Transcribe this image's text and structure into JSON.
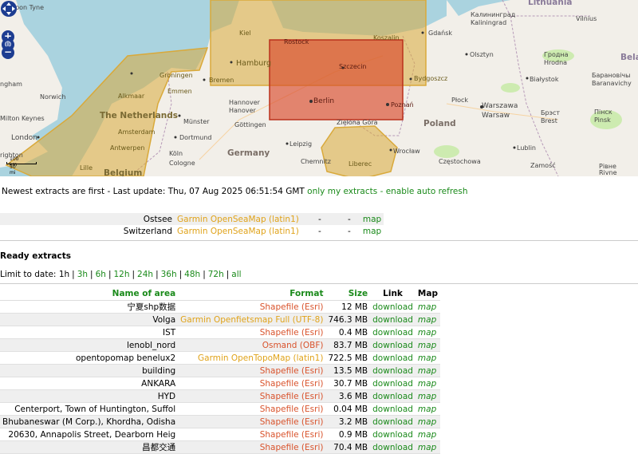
{
  "map": {
    "labels": {
      "newcastle": "upon Tyne",
      "lithuania": "Lithuania",
      "vilnius": "Vilnius",
      "kaliningrad_ru": "Калининград",
      "kaliningrad": "Kaliningrad",
      "gdansk": "Gdańsk",
      "olsztyn": "Olsztyn",
      "grodno_ru": "Гродна",
      "grodno": "Hrodna",
      "bela": "Bela",
      "bialystok": "Białystok",
      "baranovichi_ru": "Барановічы",
      "baranovichi": "Baranavichy",
      "kiel": "Kiel",
      "rostock": "Rostock",
      "koszalin": "Koszalin",
      "hamburg": "Hamburg",
      "szczecin": "Szczecin",
      "bydgoszcz": "Bydgoszcz",
      "bremen": "Bremen",
      "groningen": "Groningen",
      "emmen": "Emmen",
      "ngham": "ngham",
      "norwich": "Norwich",
      "alkmaar": "Alkmaar",
      "hannover": "Hannover",
      "hannover2": "Hanover",
      "berlin": "Berlin",
      "poznan": "Poznań",
      "plock": "Płock",
      "warszawa": "Warszawa",
      "warsaw": "Warsaw",
      "brest_ru": "Брэст",
      "brest": "Brest",
      "pinsk_ru": "Пінск",
      "pinsk": "Pinsk",
      "milton_keynes": "Milton Keynes",
      "netherlands": "The Netherlands",
      "munster": "Münster",
      "gottingen": "Göttingen",
      "zielona": "Zielona Góra",
      "poland": "Poland",
      "london": "London",
      "amsterdam": "Amsterdam",
      "dortmund": "Dortmund",
      "germany": "Germany",
      "leipzig": "Leipzig",
      "wroclaw": "Wrocław",
      "lublin": "Lublin",
      "rivne_ru": "Рівне",
      "rivne": "Rivne",
      "antwerpen": "Antwerpen",
      "koln": "Köln",
      "cologne": "Cologne",
      "chemnitz": "Chemnitz",
      "liberec": "Liberec",
      "czestochowa": "Częstochowa",
      "zamosc": "Zamość",
      "lille": "Lille",
      "belgium": "Belgium",
      "brighton": "righton"
    },
    "scale_km": "100 km",
    "scale_mi": "50 mi",
    "zoom_in": "+",
    "zoom_out": "−",
    "globe": "◍"
  },
  "status": {
    "prefix": "Newest extracts are first - Last update: Thu, 07 Aug 2025 06:51:54 GMT",
    "only_mine": "only my extracts",
    "dash": "-",
    "auto_refresh": "enable auto refresh"
  },
  "pending": [
    {
      "name": "Ostsee",
      "format": "Garmin OpenSeaMap (latin1)",
      "a": "-",
      "b": "-",
      "link": "map"
    },
    {
      "name": "Switzerland",
      "format": "Garmin OpenSeaMap (latin1)",
      "a": "-",
      "b": "-",
      "link": "map"
    }
  ],
  "ready_heading": "Ready extracts",
  "limit": {
    "label": "Limit to date:",
    "options": [
      "1h",
      "3h",
      "6h",
      "12h",
      "24h",
      "36h",
      "48h",
      "72h",
      "all"
    ],
    "sep": "|"
  },
  "table": {
    "headers": {
      "name": "Name of area",
      "format": "Format",
      "size": "Size",
      "link": "Link",
      "map": "Map"
    },
    "rows": [
      {
        "name": "宁夏shp数据",
        "format": "Shapefile (Esri)",
        "fmt_color": "red",
        "size": "12 MB",
        "link": "download",
        "map": "map"
      },
      {
        "name": "Volga",
        "format": "Garmin Openfietsmap Full (UTF-8)",
        "fmt_color": "orange",
        "size": "746.3 MB",
        "link": "download",
        "map": "map"
      },
      {
        "name": "IST",
        "format": "Shapefile (Esri)",
        "fmt_color": "red",
        "size": "0.4 MB",
        "link": "download",
        "map": "map"
      },
      {
        "name": "lenobl_nord",
        "format": "Osmand (OBF)",
        "fmt_color": "red",
        "size": "83.7 MB",
        "link": "download",
        "map": "map"
      },
      {
        "name": "opentopomap benelux2",
        "format": "Garmin OpenTopoMap (latin1)",
        "fmt_color": "orange",
        "size": "722.5 MB",
        "link": "download",
        "map": "map"
      },
      {
        "name": "building",
        "format": "Shapefile (Esri)",
        "fmt_color": "red",
        "size": "13.5 MB",
        "link": "download",
        "map": "map"
      },
      {
        "name": "ANKARA",
        "format": "Shapefile (Esri)",
        "fmt_color": "red",
        "size": "30.7 MB",
        "link": "download",
        "map": "map"
      },
      {
        "name": "HYD",
        "format": "Shapefile (Esri)",
        "fmt_color": "red",
        "size": "3.6 MB",
        "link": "download",
        "map": "map"
      },
      {
        "name": "Centerport, Town of Huntington, Suffol",
        "format": "Shapefile (Esri)",
        "fmt_color": "red",
        "size": "0.04 MB",
        "link": "download",
        "map": "map"
      },
      {
        "name": "Bhubaneswar (M Corp.), Khordha, Odisha",
        "format": "Shapefile (Esri)",
        "fmt_color": "red",
        "size": "3.2 MB",
        "link": "download",
        "map": "map"
      },
      {
        "name": "20630, Annapolis Street, Dearborn Heig",
        "format": "Shapefile (Esri)",
        "fmt_color": "red",
        "size": "0.9 MB",
        "link": "download",
        "map": "map"
      },
      {
        "name": "昌都交通",
        "format": "Shapefile (Esri)",
        "fmt_color": "red",
        "size": "70.4 MB",
        "link": "download",
        "map": "map"
      }
    ]
  },
  "colors": {
    "sea": "#aad3df",
    "land": "#f2efe9",
    "extract_fill": "#d9a93a",
    "active_fill": "#d94a2c",
    "link": "#1a8a1a",
    "format_orange": "#e0a31a",
    "format_red": "#d9532c"
  }
}
